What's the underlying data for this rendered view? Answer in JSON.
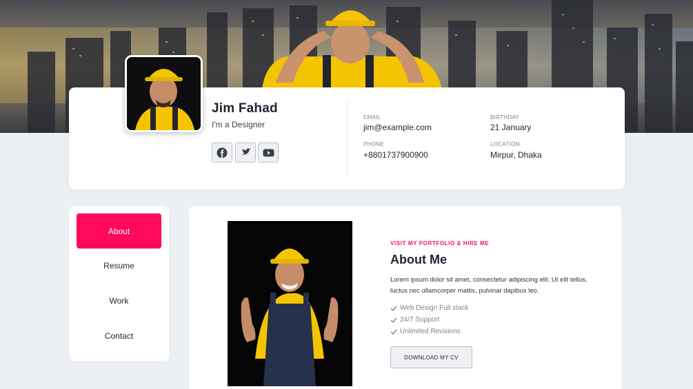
{
  "header": {
    "name": "Jim Fahad",
    "role": "I'm a Designer",
    "social": [
      {
        "icon": "facebook-icon"
      },
      {
        "icon": "twitter-icon"
      },
      {
        "icon": "youtube-icon"
      }
    ],
    "info": {
      "email": {
        "label": "EMAIL",
        "value": "jim@example.com"
      },
      "birthday": {
        "label": "BIRTHDAY",
        "value": "21 January"
      },
      "phone": {
        "label": "PHONE",
        "value": "+8801737900900"
      },
      "location": {
        "label": "LOCATION",
        "value": "Mirpur, Dhaka"
      }
    }
  },
  "sidebar": {
    "items": [
      {
        "label": "About",
        "active": true
      },
      {
        "label": "Resume",
        "active": false
      },
      {
        "label": "Work",
        "active": false
      },
      {
        "label": "Contact",
        "active": false
      }
    ]
  },
  "about": {
    "eyebrow": "VISIT MY PORTFOLIO & HIRE ME",
    "title": "About Me",
    "bio": "Lorem ipsum dolor sit amet, consectetur adipiscing elit. Ut elit tellus, luctus nec ullamcorper mattis, pulvinar dapibus leo.",
    "features": [
      "Web Design Full stack",
      "24/7 Support",
      "Unlimited Revisions"
    ],
    "cv_button": "DOWNLOAD MY CV"
  },
  "colors": {
    "accent": "#ff0a5a",
    "page_bg": "#eceff3",
    "card_bg": "#ffffff"
  }
}
